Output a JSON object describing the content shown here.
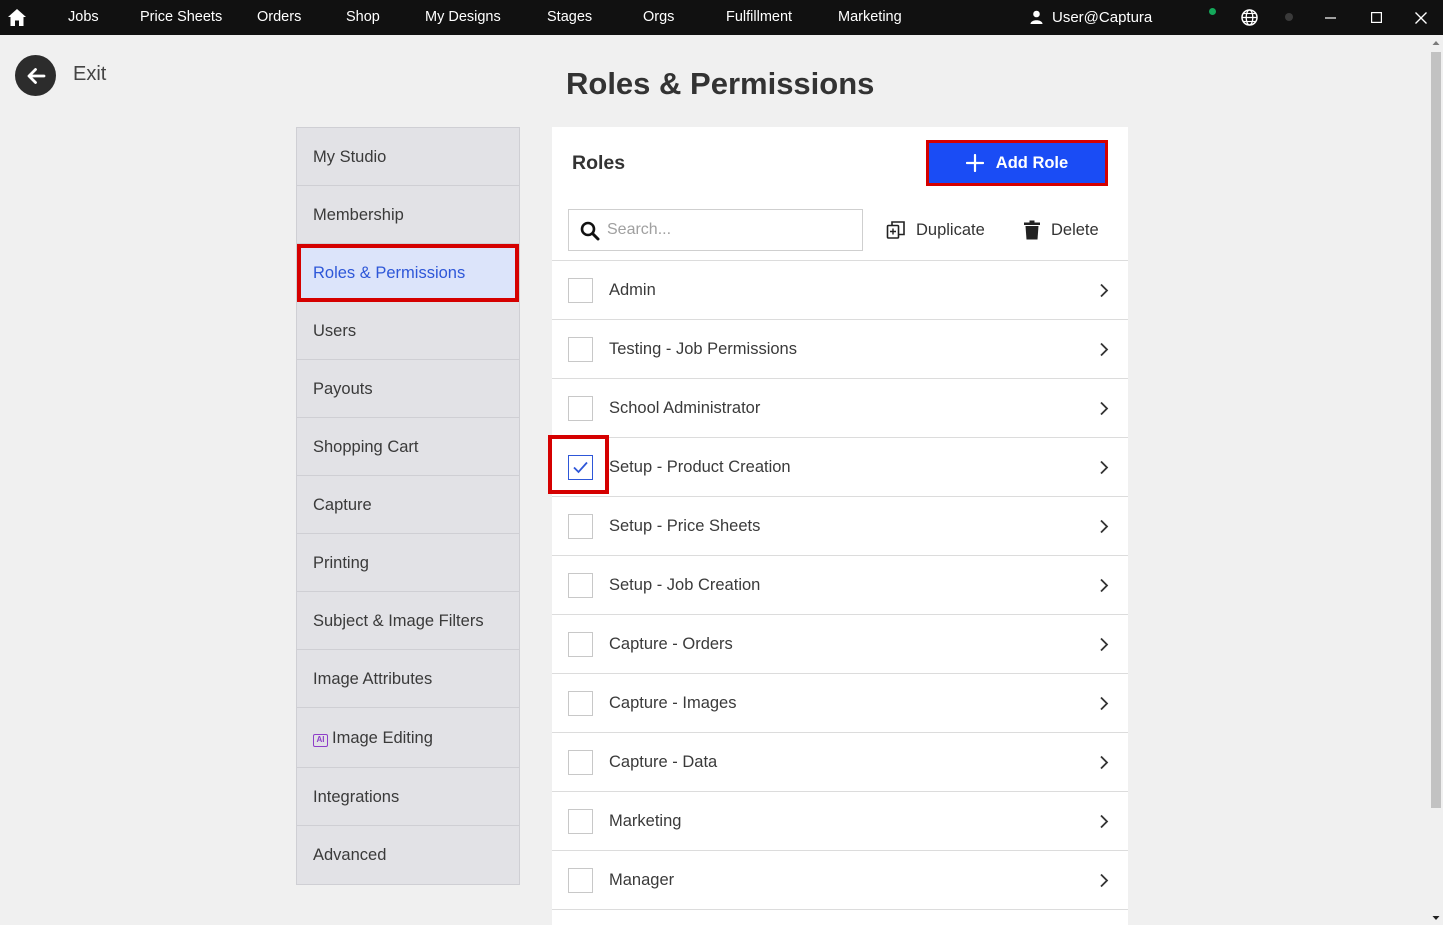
{
  "topbar": {
    "nav": [
      "Jobs",
      "Price Sheets",
      "Orders",
      "Shop",
      "My Designs",
      "Stages",
      "Orgs",
      "Fulfillment",
      "Marketing"
    ],
    "user": "User@Captura"
  },
  "exit_label": "Exit",
  "page_title": "Roles & Permissions",
  "sidebar": {
    "items": [
      {
        "label": "My Studio"
      },
      {
        "label": "Membership"
      },
      {
        "label": "Roles & Permissions",
        "active": true
      },
      {
        "label": "Users"
      },
      {
        "label": "Payouts"
      },
      {
        "label": "Shopping Cart"
      },
      {
        "label": "Capture"
      },
      {
        "label": "Printing"
      },
      {
        "label": "Subject & Image Filters"
      },
      {
        "label": "Image Attributes"
      },
      {
        "label": "Image Editing",
        "badge": "AI"
      },
      {
        "label": "Integrations"
      },
      {
        "label": "Advanced"
      }
    ]
  },
  "roles_panel": {
    "title": "Roles",
    "add_button": "Add Role",
    "search_placeholder": "Search...",
    "duplicate_label": "Duplicate",
    "delete_label": "Delete",
    "roles": [
      {
        "label": "Admin",
        "checked": false
      },
      {
        "label": "Testing - Job Permissions",
        "checked": false
      },
      {
        "label": "School Administrator",
        "checked": false
      },
      {
        "label": "Setup - Product Creation",
        "checked": true
      },
      {
        "label": "Setup - Price Sheets",
        "checked": false
      },
      {
        "label": "Setup - Job Creation",
        "checked": false
      },
      {
        "label": "Capture - Orders",
        "checked": false
      },
      {
        "label": "Capture - Images",
        "checked": false
      },
      {
        "label": "Capture - Data",
        "checked": false
      },
      {
        "label": "Marketing",
        "checked": false
      },
      {
        "label": "Manager",
        "checked": false
      }
    ]
  },
  "colors": {
    "accent": "#1a4cf5",
    "highlight_frame": "#d50000",
    "active_item_bg": "#dce4fa",
    "online_status": "#14a85a"
  }
}
